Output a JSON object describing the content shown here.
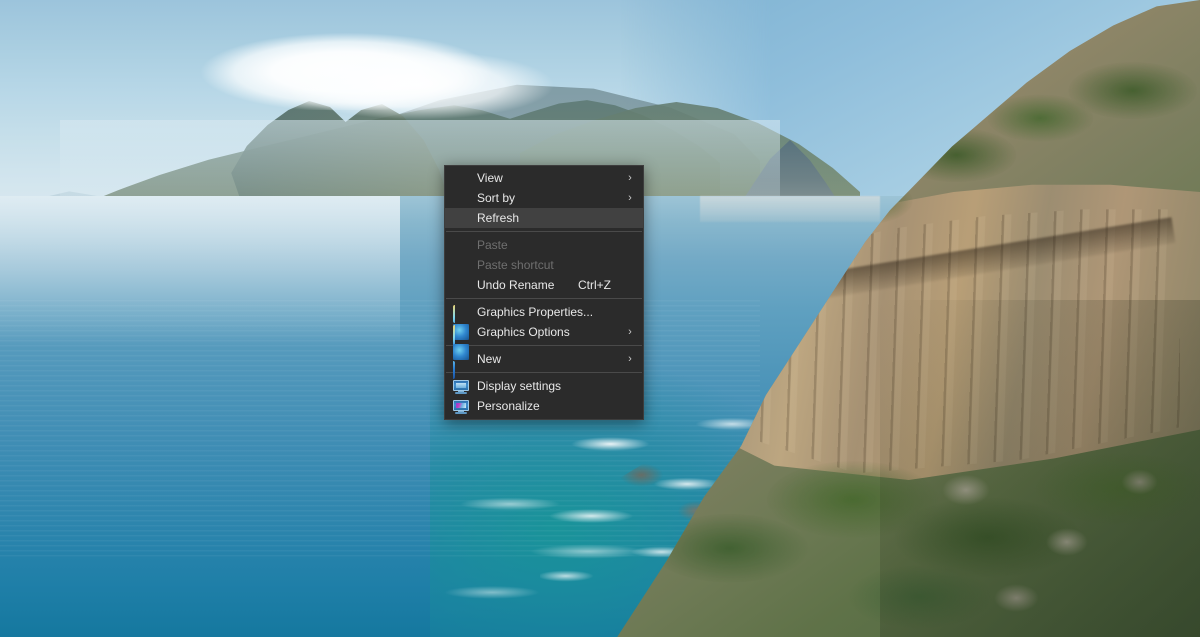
{
  "desktop": {
    "wallpaper_name": "hout-bay-coastline-wallpaper",
    "wallpaper_alt": "Coastal cliff overlooking a blue bay with mountains under a hazy sky"
  },
  "context_menu": {
    "name": "desktop-context-menu",
    "background_color": "#2b2b2b",
    "highlight_color": "#414141",
    "text_color": "#e8e8e8",
    "disabled_text_color": "#6f6f6f",
    "separator_color": "#4a4a4a",
    "groups": [
      {
        "items": [
          {
            "label": "View",
            "icon": "none",
            "submenu_arrow": true,
            "shortcut": "",
            "state": "normal"
          },
          {
            "label": "Sort by",
            "icon": "none",
            "submenu_arrow": true,
            "shortcut": "",
            "state": "normal"
          },
          {
            "label": "Refresh",
            "icon": "none",
            "submenu_arrow": false,
            "shortcut": "",
            "state": "highlighted"
          }
        ]
      },
      {
        "items": [
          {
            "label": "Paste",
            "icon": "none",
            "submenu_arrow": false,
            "shortcut": "",
            "state": "disabled"
          },
          {
            "label": "Paste shortcut",
            "icon": "none",
            "submenu_arrow": false,
            "shortcut": "",
            "state": "disabled"
          },
          {
            "label": "Undo Rename",
            "icon": "none",
            "submenu_arrow": false,
            "shortcut": "Ctrl+Z",
            "state": "normal"
          }
        ]
      },
      {
        "items": [
          {
            "label": "Graphics Properties...",
            "icon": "graphics-icon",
            "submenu_arrow": false,
            "shortcut": "",
            "state": "normal"
          },
          {
            "label": "Graphics Options",
            "icon": "graphics-icon",
            "submenu_arrow": true,
            "shortcut": "",
            "state": "normal"
          }
        ]
      },
      {
        "items": [
          {
            "label": "New",
            "icon": "none",
            "submenu_arrow": true,
            "shortcut": "",
            "state": "normal"
          }
        ]
      },
      {
        "items": [
          {
            "label": "Display settings",
            "icon": "monitor-icon",
            "submenu_arrow": false,
            "shortcut": "",
            "state": "normal"
          },
          {
            "label": "Personalize",
            "icon": "personalize-icon",
            "submenu_arrow": false,
            "shortcut": "",
            "state": "normal"
          }
        ]
      }
    ],
    "submenu_arrow_glyph": "›"
  }
}
